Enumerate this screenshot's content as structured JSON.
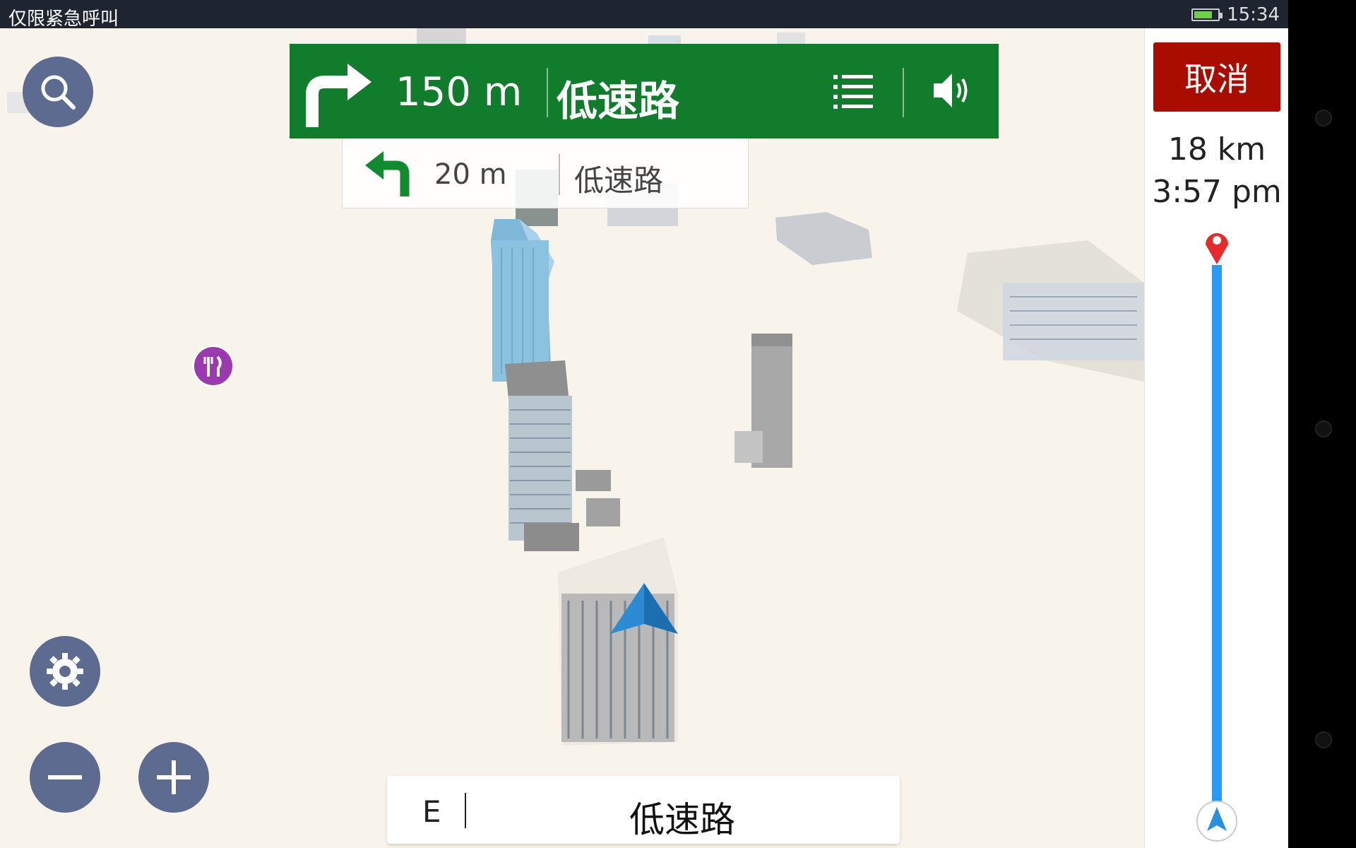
{
  "status_bar": {
    "left_text": "仅限紧急呼叫",
    "time": "15:34"
  },
  "instruction": {
    "distance": "150 m",
    "road": "低速路",
    "turn": "right",
    "icons": [
      "turn-right-icon",
      "list-icon",
      "volume-icon"
    ],
    "color": "#107c2c"
  },
  "next_instruction": {
    "distance": "20 m",
    "road": "低速路",
    "turn": "left"
  },
  "route_panel": {
    "cancel_label": "取消",
    "remaining_distance": "18 km",
    "eta": "3:57 pm",
    "cancel_color": "#a80d00",
    "progress_color": "#2b9af3"
  },
  "road_bar": {
    "heading": "E",
    "current_road": "低速路"
  },
  "map_controls": {
    "icons": [
      "search-icon",
      "gear-icon",
      "minus-icon",
      "plus-icon"
    ]
  },
  "map": {
    "poi": "restaurant-icon"
  }
}
